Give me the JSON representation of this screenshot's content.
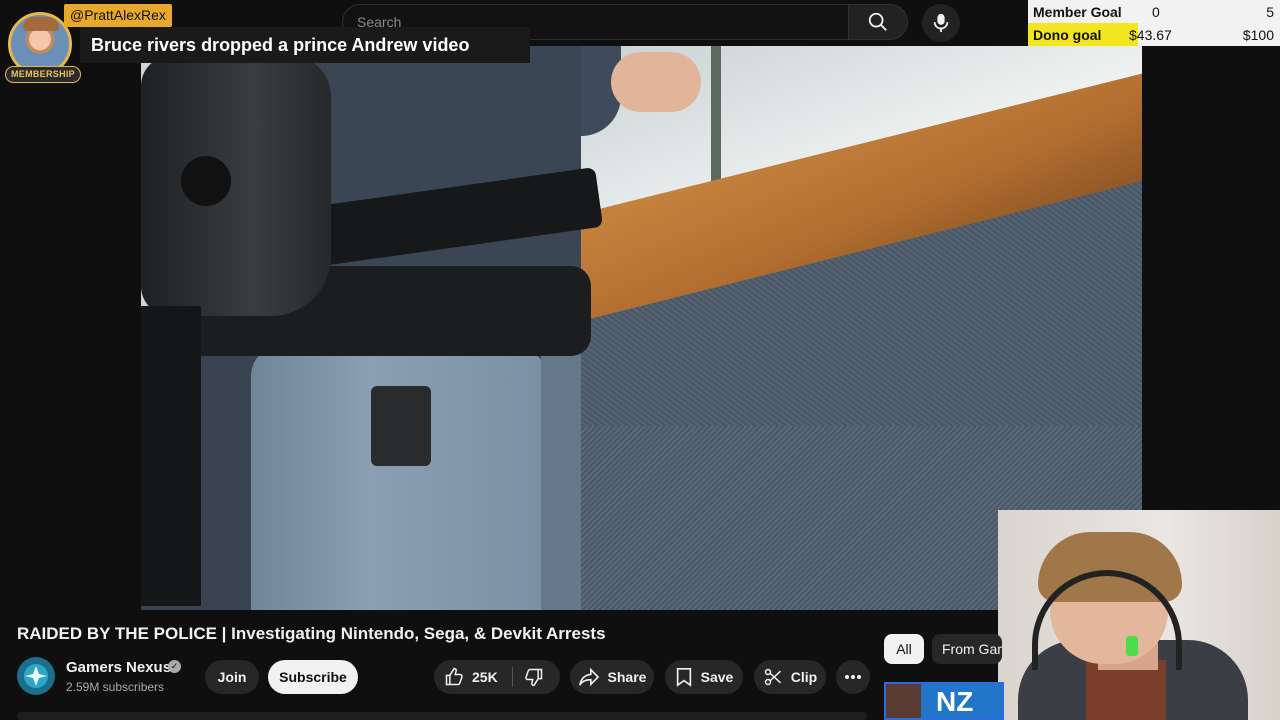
{
  "search": {
    "placeholder": "Search"
  },
  "goals": {
    "member": {
      "label": "Member Goal",
      "current": "0",
      "target": "5",
      "progress": 0.0
    },
    "dono": {
      "label": "Dono goal",
      "current": "$43.67",
      "target": "$100",
      "progress": 0.4367
    },
    "fill_color": "#f3e520"
  },
  "alert": {
    "username": "@PrattAlexRex",
    "message": "Bruce rivers dropped a prince Andrew video",
    "tag": "MEMBERSHIP",
    "accent": "#e8a82a"
  },
  "video": {
    "title": "RAIDED BY THE POLICE | Investigating Nintendo, Sega, & Devkit Arrests",
    "channel": "Gamers Nexus",
    "subscribers": "2.59M subscribers",
    "like_count": "25K"
  },
  "actions": {
    "join": "Join",
    "subscribe": "Subscribe",
    "share": "Share",
    "save": "Save",
    "clip": "Clip"
  },
  "chips": {
    "all": "All",
    "from": "From Gam"
  },
  "thumbnail": {
    "text": "NZ"
  },
  "icons": {
    "search": "search-icon",
    "mic": "mic-icon",
    "like": "thumbs-up-icon",
    "dislike": "thumbs-down-icon",
    "share": "share-icon",
    "save": "bookmark-icon",
    "clip": "scissors-icon",
    "more": "more-horizontal-icon",
    "verified": "verified-check-icon"
  }
}
